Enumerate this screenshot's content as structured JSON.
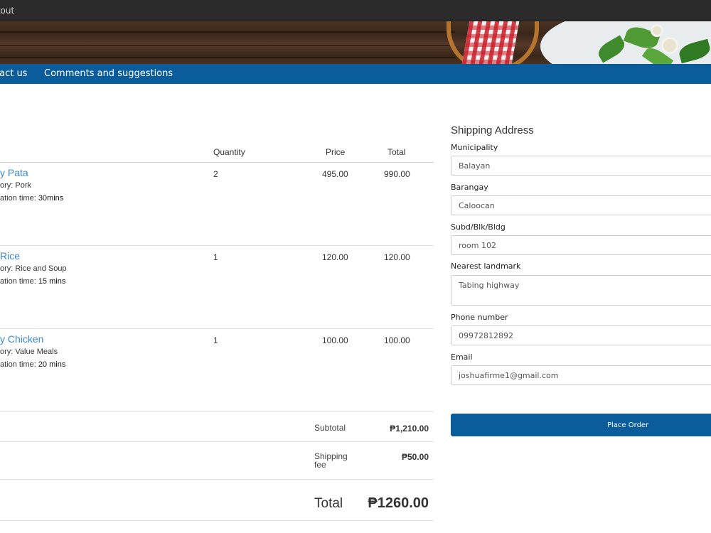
{
  "window": {
    "title": "kout"
  },
  "nav": {
    "links": [
      "tact us",
      "Comments and suggestions"
    ]
  },
  "cart": {
    "headers": {
      "quantity": "Quantity",
      "price": "Price",
      "total": "Total"
    },
    "items": [
      {
        "name": "y Pata",
        "category": "ory: Pork",
        "prep_prefix": "ation time: ",
        "prep_value": "30mins",
        "quantity": "2",
        "price": "495.00",
        "total": "990.00"
      },
      {
        "name": "Rice",
        "category": "ory: Rice and Soup",
        "prep_prefix": "ation time: ",
        "prep_value": "15 mins",
        "quantity": "1",
        "price": "120.00",
        "total": "120.00"
      },
      {
        "name": "y Chicken",
        "category": "ory: Value Meals",
        "prep_prefix": "ation time: ",
        "prep_value": "20 mins",
        "quantity": "1",
        "price": "100.00",
        "total": "100.00"
      }
    ],
    "subtotal_label": "Subtotal",
    "subtotal_value": "₱1,210.00",
    "shipping_label": "Shipping fee",
    "shipping_value": "₱50.00",
    "total_label": "Total",
    "total_value": "₱1260.00"
  },
  "shipping": {
    "title": "Shipping Address",
    "fields": {
      "municipality": {
        "label": "Municipality",
        "value": "Balayan"
      },
      "barangay": {
        "label": "Barangay",
        "value": "Caloocan"
      },
      "subd": {
        "label": "Subd/Blk/Bldg",
        "value": "room 102"
      },
      "landmark": {
        "label": "Nearest landmark",
        "value": "Tabing highway"
      },
      "phone": {
        "label": "Phone number",
        "value": "09972812892"
      },
      "email": {
        "label": "Email",
        "value": "joshuafirme1@gmail.com"
      }
    },
    "button_label": "Place Order"
  },
  "colors": {
    "navbar": "#0a5c9b",
    "link": "#3a87c9",
    "button": "#0a5c9b"
  }
}
